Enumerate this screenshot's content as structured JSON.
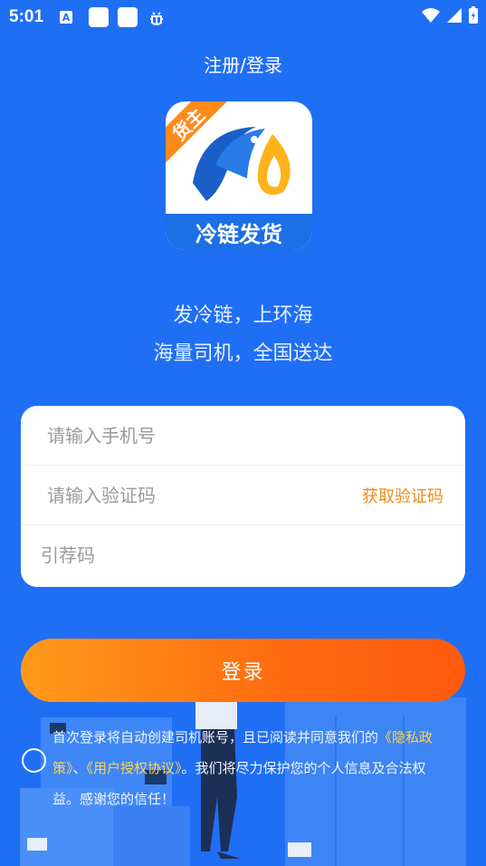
{
  "status_bar": {
    "time": "5:01",
    "icons": [
      "a-icon",
      "notification-square-icon",
      "notification-square-icon",
      "bug-icon",
      "wifi-icon",
      "signal-icon",
      "battery-icon"
    ]
  },
  "header": {
    "title": "注册/登录"
  },
  "logo": {
    "ribbon_text": "货主",
    "band_text": "冷链发货"
  },
  "slogan": {
    "line1": "发冷链，上环海",
    "line2": "海量司机，全国送达"
  },
  "form": {
    "phone_placeholder": "请输入手机号",
    "code_placeholder": "请输入验证码",
    "get_code_label": "获取验证码",
    "referral_placeholder": "引荐码"
  },
  "login_button": {
    "label": "登录"
  },
  "agreement": {
    "text_before": "首次登录将自动创建司机账号，且已阅读并同意我们的",
    "privacy_link": "《隐私政策》",
    "separator": "、",
    "user_agreement_link": "《用户授权协议》",
    "text_after": "。我们将尽力保护您的个人信息及合法权益。感谢您的信任！"
  },
  "colors": {
    "background": "#1f6ff5",
    "accent_orange": "#ff7a14",
    "link_yellow": "#ffd44d",
    "get_code_orange": "#f0891a"
  }
}
